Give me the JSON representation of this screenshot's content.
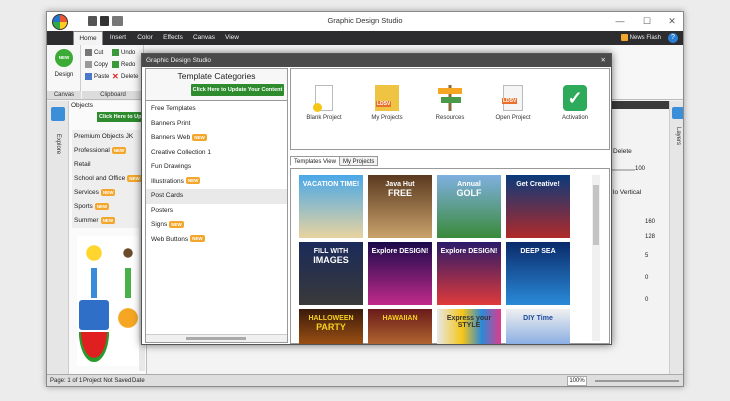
{
  "window": {
    "title": "Graphic Design Studio",
    "controls": {
      "minimize": "—",
      "maximize": "☐",
      "close": "✕"
    }
  },
  "ribbon": {
    "tabs": [
      "Home",
      "Insert",
      "Color",
      "Effects",
      "Canvas",
      "View"
    ],
    "news_flash": "News Flash",
    "help": "?",
    "design_label": "Design",
    "new_badge": "NEW",
    "clipboard": {
      "cut": "Cut",
      "copy": "Copy",
      "paste": "Paste",
      "undo": "Undo",
      "redo": "Redo",
      "delete": "Delete"
    },
    "groups": {
      "canvas": "Canvas",
      "clipboard": "Clipboard"
    }
  },
  "objects_pane": {
    "title": "Objects",
    "side_tab": "Explore",
    "update_button": "Click Here to Up",
    "categories": [
      {
        "label": "Premium Objects JK",
        "badge": ""
      },
      {
        "label": "Professional",
        "badge": "NEW"
      },
      {
        "label": "Retail",
        "badge": ""
      },
      {
        "label": "School and Office",
        "badge": "NEW"
      },
      {
        "label": "Services",
        "badge": "NEW"
      },
      {
        "label": "Sports",
        "badge": "NEW"
      },
      {
        "label": "Summer",
        "badge": "NEW"
      }
    ]
  },
  "right_pane": {
    "side_tab": "Layers",
    "delete_label": "Delete",
    "flip_vertical": "lo Vertical",
    "values": [
      "100",
      "160",
      "128",
      "5",
      "0",
      "0"
    ]
  },
  "statusbar": {
    "page": "Page: 1 of 1",
    "project": "Project Not Saved",
    "date": "Date",
    "zoom": "100%"
  },
  "dialog": {
    "title": "Graphic Design Studio",
    "close": "✕",
    "categories_title": "Template Categories",
    "update_button": "Click Here to Update Your Content",
    "new_badge": "NEW",
    "categories": [
      {
        "label": "Free Templates",
        "badge": ""
      },
      {
        "label": "Banners Print",
        "badge": ""
      },
      {
        "label": "Banners Web",
        "badge": "NEW"
      },
      {
        "label": "Creative Collection 1",
        "badge": ""
      },
      {
        "label": "Fun Drawings",
        "badge": ""
      },
      {
        "label": "Illustrations",
        "badge": "NEW"
      },
      {
        "label": "Post Cards",
        "badge": ""
      },
      {
        "label": "Posters",
        "badge": ""
      },
      {
        "label": "Signs",
        "badge": "NEW"
      },
      {
        "label": "Web Buttons",
        "badge": "NEW"
      }
    ],
    "selected_category": "Post Cards",
    "launch": [
      {
        "label": "Blank Project",
        "icon": "blank-page-icon"
      },
      {
        "label": "My Projects",
        "icon": "ldsv-folder-icon"
      },
      {
        "label": "Resources",
        "icon": "signpost-icon"
      },
      {
        "label": "Open Project",
        "icon": "ldsv-file-icon"
      },
      {
        "label": "Activation",
        "icon": "checkmark-icon"
      }
    ],
    "ldsv": "LDSV",
    "tabs": [
      "Templates View",
      "My Projects"
    ],
    "templates": [
      {
        "text": "VACATION TIME!",
        "sub": ""
      },
      {
        "text": "Java Hut",
        "sub": "FREE"
      },
      {
        "text": "Annual",
        "sub": "GOLF"
      },
      {
        "text": "Get Creative!",
        "sub": ""
      },
      {
        "text": "FILL WITH",
        "sub": "IMAGES"
      },
      {
        "text": "Explore DESIGN!",
        "sub": ""
      },
      {
        "text": "Explore DESIGN!",
        "sub": ""
      },
      {
        "text": "DEEP SEA",
        "sub": ""
      },
      {
        "text": "HALLOWEEN",
        "sub": "PARTY"
      },
      {
        "text": "HAWAIIAN",
        "sub": ""
      },
      {
        "text": "Express your STYLE",
        "sub": ""
      },
      {
        "text": "DIY Time",
        "sub": ""
      }
    ]
  }
}
